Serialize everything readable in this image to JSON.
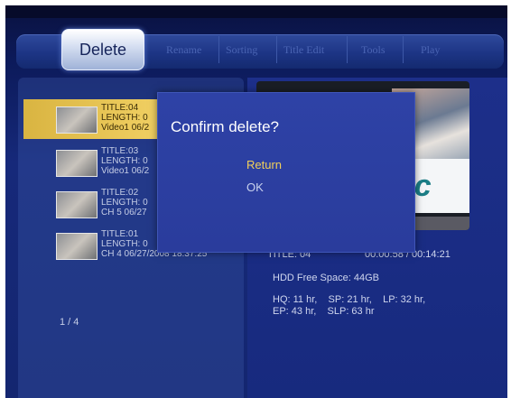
{
  "menu": {
    "tabs": [
      {
        "label": "Delete",
        "active": true
      },
      {
        "label": "Rename"
      },
      {
        "label": "Sorting"
      },
      {
        "label": "Title Edit"
      },
      {
        "label": "Tools"
      },
      {
        "label": "Play"
      }
    ]
  },
  "titles": [
    {
      "l1": "TITLE:04",
      "l2": "LENGTH: 0",
      "l3": "Video1 06/2",
      "selected": true,
      "thumb": "video-thumbnail-icon"
    },
    {
      "l1": "TITLE:03",
      "l2": "LENGTH: 0",
      "l3": "Video1 06/2",
      "thumb": "video-thumbnail-icon"
    },
    {
      "l1": "TITLE:02",
      "l2": "LENGTH: 0",
      "l3": "CH 5 06/27",
      "thumb": "video-thumbnail-icon"
    },
    {
      "l1": "TITLE:01",
      "l2": "LENGTH: 0",
      "l3": "CH 4 06/27/2008 18:37:25",
      "thumb": "video-thumbnail-icon"
    }
  ],
  "pager": "1 / 4",
  "info": {
    "title": "TITLE: 04",
    "time": "00:00:58 / 00:14:21",
    "hdd": "HDD Free Space: 44GB",
    "quality_line1": "HQ: 11 hr,    SP: 21 hr,    LP: 32 hr,",
    "quality_line2": "EP: 43 hr,    SLP: 63 hr"
  },
  "dialog": {
    "title": "Confirm delete?",
    "options": [
      "Return",
      "OK"
    ],
    "selected": "Return"
  },
  "colors": {
    "highlight": "#f0cf62",
    "dialog_bg": "#2e42a6",
    "accent_text": "#f2d05a"
  }
}
